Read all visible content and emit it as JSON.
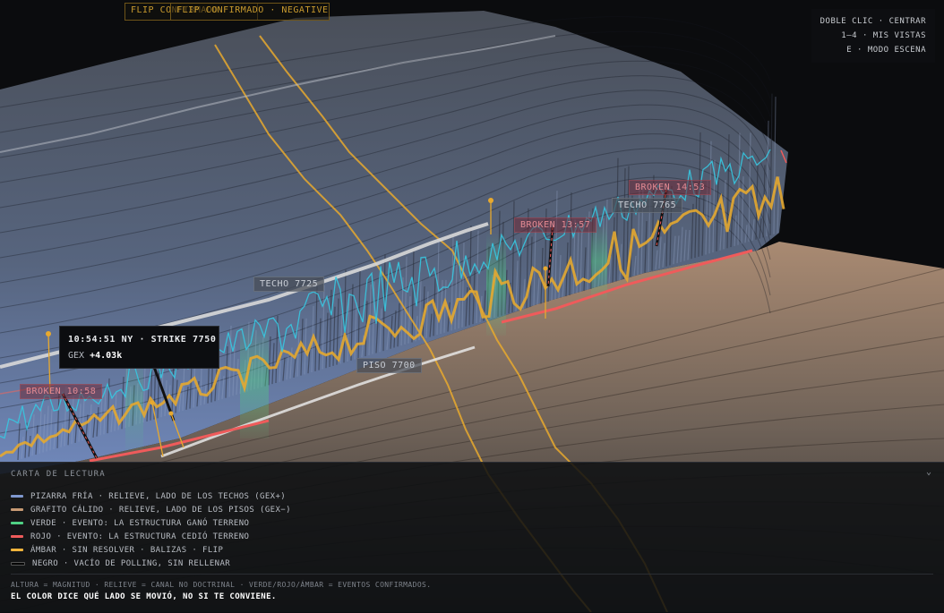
{
  "header": {
    "flip_label_a": "FLIP CONFIRMADO",
    "flip_label_b": "FLIP CONFIRMADO · NEGATIVE"
  },
  "hint": {
    "line1": "DOBLE CLIC · CENTRAR",
    "line2": "1–4 · MIS VISTAS",
    "line3": "E · MODO ESCENA"
  },
  "scene_labels": {
    "techo_1": "TECHO 7725",
    "techo_2": "TECHO 7765",
    "piso": "PISO 7700",
    "broken_1": "BROKEN 10:58",
    "broken_2": "BROKEN 13:57",
    "broken_3": "BROKEN 14:53"
  },
  "tooltip": {
    "line1": "10:54:51 NY · STRIKE 7750",
    "gex_label": "GEX",
    "gex_value": "+4.03k"
  },
  "legend": {
    "title": "CARTA DE LECTURA",
    "toggle_icon": "chevron-down-icon",
    "items": [
      {
        "color": "#7f98cf",
        "text": "PIZARRA FRÍA · RELIEVE, LADO DE LOS TECHOS (GEX+)"
      },
      {
        "color": "#c79a74",
        "text": "GRAFITO CÁLIDO · RELIEVE, LADO DE LOS PISOS (GEX−)"
      },
      {
        "color": "#4fd184",
        "text": "VERDE · EVENTO: LA ESTRUCTURA GANÓ TERRENO"
      },
      {
        "color": "#ef5b5b",
        "text": "ROJO · EVENTO: LA ESTRUCTURA CEDIÓ TERRENO"
      },
      {
        "color": "#f0b43c",
        "text": "ÁMBAR · SIN RESOLVER · BALIZAS · FLIP"
      },
      {
        "color": "#000000",
        "text": "NEGRO · VACÍO DE POLLING, SIN RELLENAR"
      }
    ],
    "footnote": "ALTURA = MAGNITUD · RELIEVE = CANAL NO DOCTRINAL · VERDE/ROJO/ÁMBAR = EVENTOS CONFIRMADOS.",
    "tagline": "EL COLOR DICE QUÉ LADO SE MOVIÓ, NO SI TE CONVIENE."
  },
  "colors": {
    "cold_relief": "#6f87b8",
    "warm_relief": "#b28d6e",
    "green": "#4fd184",
    "red": "#ef5b5b",
    "amber": "#e8a92e",
    "cyan": "#37c6e0",
    "price_white": "#e4e4e4"
  }
}
